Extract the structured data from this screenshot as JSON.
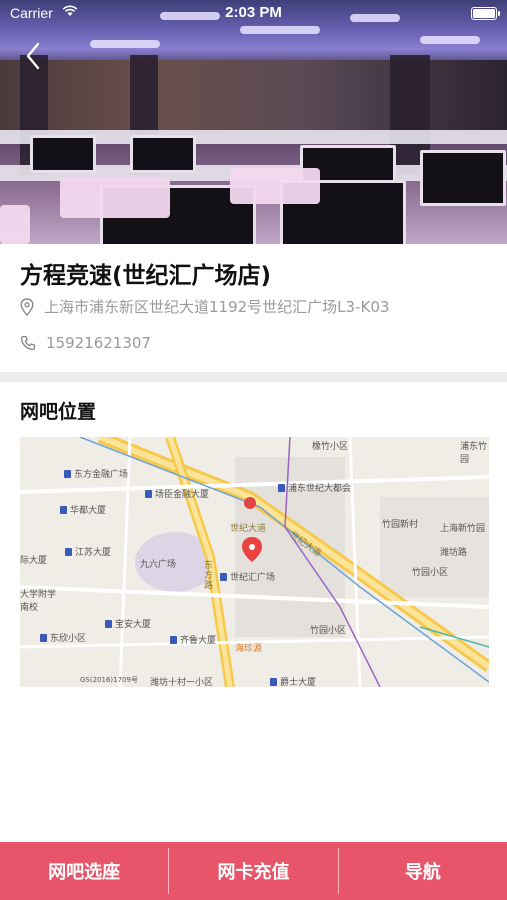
{
  "status_bar": {
    "carrier": "Carrier",
    "time": "2:03 PM"
  },
  "venue": {
    "name": "方程竞速(世纪汇广场店)",
    "address": "上海市浦东新区世纪大道1192号世纪汇广场L3-K03",
    "phone": "15921621307"
  },
  "location_section": {
    "title": "网吧位置"
  },
  "map": {
    "labels": [
      {
        "text": "东方金融广场",
        "kind": "bld"
      },
      {
        "text": "场臣金融大厦",
        "kind": "bld"
      },
      {
        "text": "浦东世纪大都会",
        "kind": "bld"
      },
      {
        "text": "华都大厦",
        "kind": "bld"
      },
      {
        "text": "世纪大道",
        "kind": "road"
      },
      {
        "text": "竹园新村",
        "kind": "plain"
      },
      {
        "text": "江苏大厦",
        "kind": "bld"
      },
      {
        "text": "九六广场",
        "kind": "plain"
      },
      {
        "text": "世纪汇广场",
        "kind": "bld"
      },
      {
        "text": "大学附学南校",
        "kind": "plain"
      },
      {
        "text": "宝安大厦",
        "kind": "bld"
      },
      {
        "text": "东欣小区",
        "kind": "bld"
      },
      {
        "text": "齐鲁大厦",
        "kind": "bld"
      },
      {
        "text": "竹园小区",
        "kind": "plain"
      },
      {
        "text": "潍坊十村一小区",
        "kind": "plain"
      },
      {
        "text": "爵士大厦",
        "kind": "bld"
      },
      {
        "text": "橡竹小区",
        "kind": "plain"
      },
      {
        "text": "浦东竹园",
        "kind": "plain"
      },
      {
        "text": "上海新竹园",
        "kind": "plain"
      },
      {
        "text": "潍坊路",
        "kind": "plain"
      },
      {
        "text": "竹园小区",
        "kind": "plain"
      },
      {
        "text": "东方路",
        "kind": "road"
      },
      {
        "text": "世纪大道",
        "kind": "road"
      },
      {
        "text": "海珍源",
        "kind": "road"
      },
      {
        "text": "际大厦",
        "kind": "plain"
      },
      {
        "text": "GS(2016)1709号",
        "kind": "plain"
      }
    ]
  },
  "bottom_bar": {
    "seat_label": "网吧选座",
    "recharge_label": "网卡充值",
    "navigate_label": "导航"
  },
  "colors": {
    "accent": "#e8556b"
  }
}
